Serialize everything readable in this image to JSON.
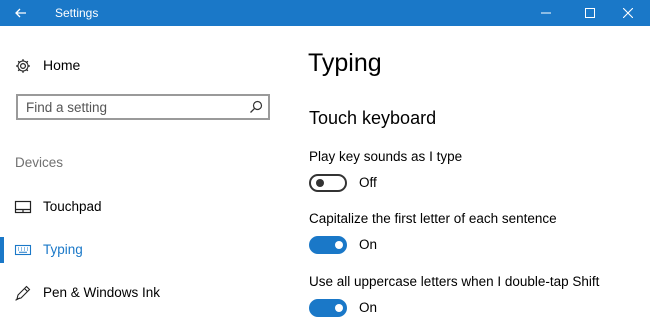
{
  "window": {
    "title": "Settings",
    "accent_color": "#1a78c8"
  },
  "sidebar": {
    "home_label": "Home",
    "search_placeholder": "Find a setting",
    "section_header": "Devices",
    "items": [
      {
        "label": "Touchpad",
        "icon": "touchpad-icon",
        "selected": false
      },
      {
        "label": "Typing",
        "icon": "keyboard-icon",
        "selected": true
      },
      {
        "label": "Pen & Windows Ink",
        "icon": "pen-icon",
        "selected": false
      }
    ]
  },
  "main": {
    "page_title": "Typing",
    "group_title": "Touch keyboard",
    "settings": [
      {
        "label": "Play key sounds as I type",
        "state": "Off",
        "on": false
      },
      {
        "label": "Capitalize the first letter of each sentence",
        "state": "On",
        "on": true
      },
      {
        "label": "Use all uppercase letters when I double-tap Shift",
        "state": "On",
        "on": true
      }
    ]
  }
}
